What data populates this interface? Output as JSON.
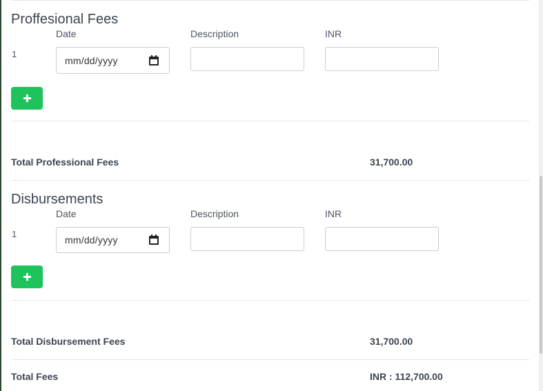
{
  "professional": {
    "title": "Proffesional Fees",
    "columns": {
      "date": "Date",
      "description": "Description",
      "inr": "INR"
    },
    "rows": [
      {
        "num": "1",
        "date_placeholder": "mm/dd/yyyy",
        "description": "",
        "inr": ""
      }
    ],
    "total_label": "Total Professional Fees",
    "total_value": "31,700.00"
  },
  "disbursements": {
    "title": "Disbursements",
    "columns": {
      "date": "Date",
      "description": "Description",
      "inr": "INR"
    },
    "rows": [
      {
        "num": "1",
        "date_placeholder": "mm/dd/yyyy",
        "description": "",
        "inr": ""
      }
    ],
    "total_label": "Total Disbursement Fees",
    "total_value": "31,700.00"
  },
  "summary": {
    "total_label": "Total Fees",
    "total_value": "INR : 112,700.00"
  },
  "icons": {
    "add": "plus-icon",
    "calendar": "calendar-icon"
  },
  "colors": {
    "add_button": "#1ec35c",
    "frame": "#2b4a31"
  }
}
